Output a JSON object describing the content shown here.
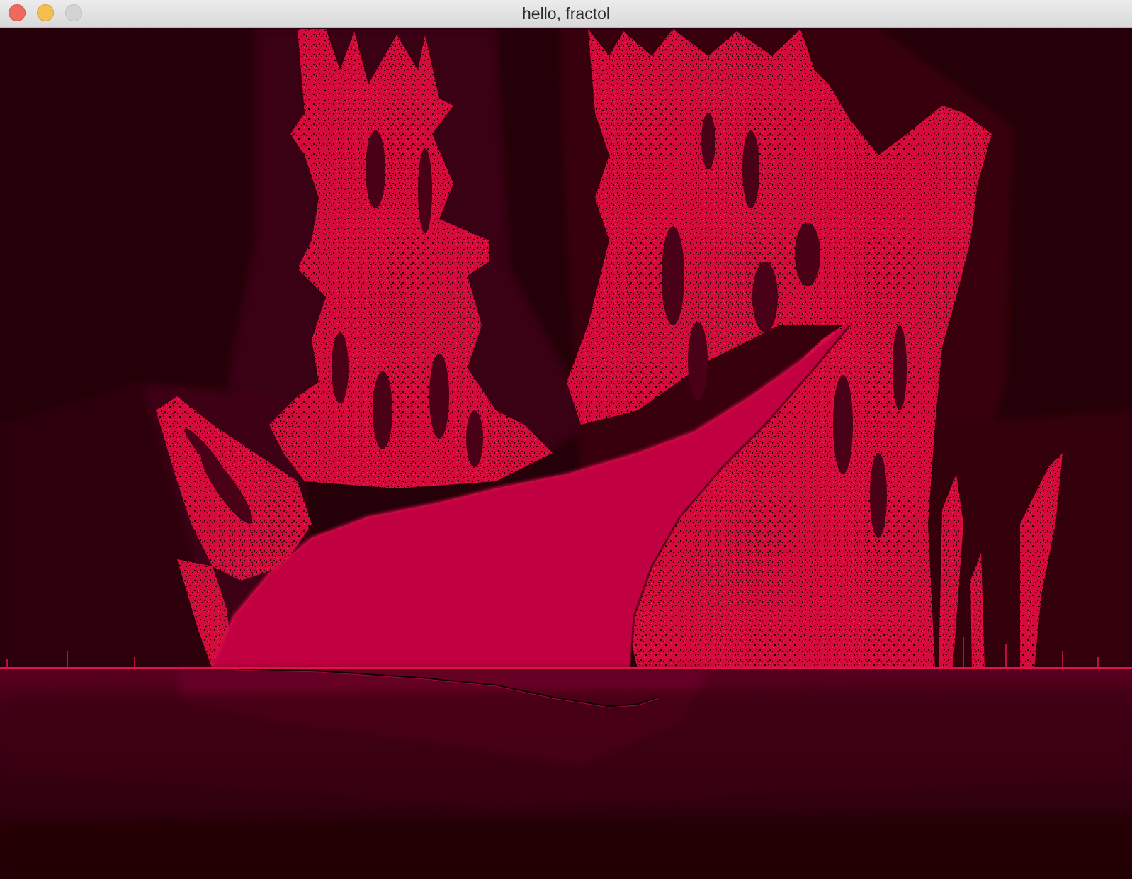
{
  "window": {
    "title": "hello, fractol",
    "controls": {
      "close": "close-button",
      "minimize": "minimize-button",
      "zoom": "zoom-button"
    }
  },
  "canvas": {
    "content": "fractal-render",
    "colors": {
      "background_dark": "#250009",
      "background_mid": "#4a0018",
      "fractal_fill": "#c10041",
      "fractal_noise": "#e0103f",
      "speck": "#000000",
      "horizon_line": "#e0124a"
    }
  }
}
